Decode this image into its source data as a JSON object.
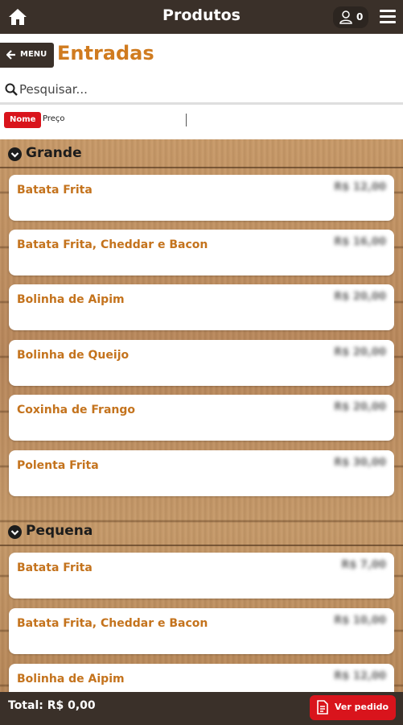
{
  "topbar": {
    "title": "Produtos",
    "user_count": "0"
  },
  "header": {
    "menu_label": "MENU",
    "section_title": "Entradas"
  },
  "search": {
    "placeholder": "Pesquisar..."
  },
  "sort": {
    "nome": "Nome",
    "preco": "Preço"
  },
  "groups": [
    {
      "label": "Grande",
      "items": [
        {
          "name": "Batata Frita",
          "price": "R$ 12,00"
        },
        {
          "name": "Batata Frita, Cheddar e Bacon",
          "price": "R$ 16,00"
        },
        {
          "name": "Bolinha de Aipim",
          "price": "R$ 20,00"
        },
        {
          "name": "Bolinha de Queijo",
          "price": "R$ 20,00"
        },
        {
          "name": "Coxinha de Frango",
          "price": "R$ 20,00"
        },
        {
          "name": "Polenta Frita",
          "price": "R$ 30,00"
        }
      ]
    },
    {
      "label": "Pequena",
      "items": [
        {
          "name": "Batata Frita",
          "price": "R$ 7,00"
        },
        {
          "name": "Batata Frita, Cheddar e Bacon",
          "price": "R$ 10,00"
        },
        {
          "name": "Bolinha de Aipim",
          "price": "R$ 12,00"
        }
      ]
    }
  ],
  "footer": {
    "total": "Total: R$ 0,00",
    "order_label": "Ver pedido"
  },
  "colors": {
    "accent": "#d07b1f",
    "bar": "#3a3029",
    "button": "#d9141c"
  }
}
